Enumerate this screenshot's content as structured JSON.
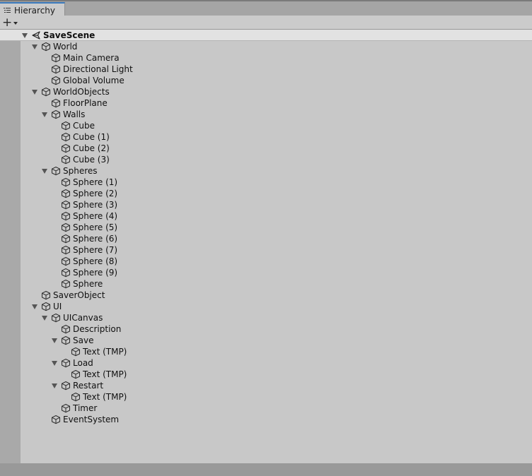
{
  "tab": {
    "title": "Hierarchy",
    "icon": "list-icon"
  },
  "toolbar": {
    "add_label": "+"
  },
  "colors": {
    "tab_accent": "#3a79bb",
    "panel_bg": "#c8c8c8",
    "scene_row_bg": "#e2e2e2"
  },
  "tree": {
    "scene": {
      "label": "SaveScene",
      "icon": "unity-scene-icon"
    },
    "items": [
      {
        "label": "World",
        "depth": 1,
        "expanded": true,
        "icon": "gameobject-cube-icon"
      },
      {
        "label": "Main Camera",
        "depth": 2,
        "expanded": null,
        "icon": "gameobject-cube-icon"
      },
      {
        "label": "Directional Light",
        "depth": 2,
        "expanded": null,
        "icon": "gameobject-cube-icon"
      },
      {
        "label": "Global Volume",
        "depth": 2,
        "expanded": null,
        "icon": "gameobject-cube-icon"
      },
      {
        "label": "WorldObjects",
        "depth": 1,
        "expanded": true,
        "icon": "gameobject-cube-icon"
      },
      {
        "label": "FloorPlane",
        "depth": 2,
        "expanded": null,
        "icon": "gameobject-cube-icon"
      },
      {
        "label": "Walls",
        "depth": 2,
        "expanded": true,
        "icon": "gameobject-cube-icon"
      },
      {
        "label": "Cube",
        "depth": 3,
        "expanded": null,
        "icon": "gameobject-cube-icon"
      },
      {
        "label": "Cube (1)",
        "depth": 3,
        "expanded": null,
        "icon": "gameobject-cube-icon"
      },
      {
        "label": "Cube (2)",
        "depth": 3,
        "expanded": null,
        "icon": "gameobject-cube-icon"
      },
      {
        "label": "Cube (3)",
        "depth": 3,
        "expanded": null,
        "icon": "gameobject-cube-icon"
      },
      {
        "label": "Spheres",
        "depth": 2,
        "expanded": true,
        "icon": "gameobject-cube-icon"
      },
      {
        "label": "Sphere (1)",
        "depth": 3,
        "expanded": null,
        "icon": "gameobject-cube-icon"
      },
      {
        "label": "Sphere (2)",
        "depth": 3,
        "expanded": null,
        "icon": "gameobject-cube-icon"
      },
      {
        "label": "Sphere (3)",
        "depth": 3,
        "expanded": null,
        "icon": "gameobject-cube-icon"
      },
      {
        "label": "Sphere (4)",
        "depth": 3,
        "expanded": null,
        "icon": "gameobject-cube-icon"
      },
      {
        "label": "Sphere (5)",
        "depth": 3,
        "expanded": null,
        "icon": "gameobject-cube-icon"
      },
      {
        "label": "Sphere (6)",
        "depth": 3,
        "expanded": null,
        "icon": "gameobject-cube-icon"
      },
      {
        "label": "Sphere (7)",
        "depth": 3,
        "expanded": null,
        "icon": "gameobject-cube-icon"
      },
      {
        "label": "Sphere (8)",
        "depth": 3,
        "expanded": null,
        "icon": "gameobject-cube-icon"
      },
      {
        "label": "Sphere (9)",
        "depth": 3,
        "expanded": null,
        "icon": "gameobject-cube-icon"
      },
      {
        "label": "Sphere",
        "depth": 3,
        "expanded": null,
        "icon": "gameobject-cube-icon"
      },
      {
        "label": "SaverObject",
        "depth": 1,
        "expanded": null,
        "icon": "gameobject-cube-icon"
      },
      {
        "label": "UI",
        "depth": 1,
        "expanded": true,
        "icon": "gameobject-cube-icon"
      },
      {
        "label": "UICanvas",
        "depth": 2,
        "expanded": true,
        "icon": "gameobject-cube-icon"
      },
      {
        "label": "Description",
        "depth": 3,
        "expanded": null,
        "icon": "gameobject-cube-icon"
      },
      {
        "label": "Save",
        "depth": 3,
        "expanded": true,
        "icon": "gameobject-cube-icon"
      },
      {
        "label": "Text (TMP)",
        "depth": 4,
        "expanded": null,
        "icon": "gameobject-cube-icon"
      },
      {
        "label": "Load",
        "depth": 3,
        "expanded": true,
        "icon": "gameobject-cube-icon"
      },
      {
        "label": "Text (TMP)",
        "depth": 4,
        "expanded": null,
        "icon": "gameobject-cube-icon"
      },
      {
        "label": "Restart",
        "depth": 3,
        "expanded": true,
        "icon": "gameobject-cube-icon"
      },
      {
        "label": "Text (TMP)",
        "depth": 4,
        "expanded": null,
        "icon": "gameobject-cube-icon"
      },
      {
        "label": "Timer",
        "depth": 3,
        "expanded": null,
        "icon": "gameobject-cube-icon"
      },
      {
        "label": "EventSystem",
        "depth": 2,
        "expanded": null,
        "icon": "gameobject-cube-icon"
      }
    ]
  }
}
